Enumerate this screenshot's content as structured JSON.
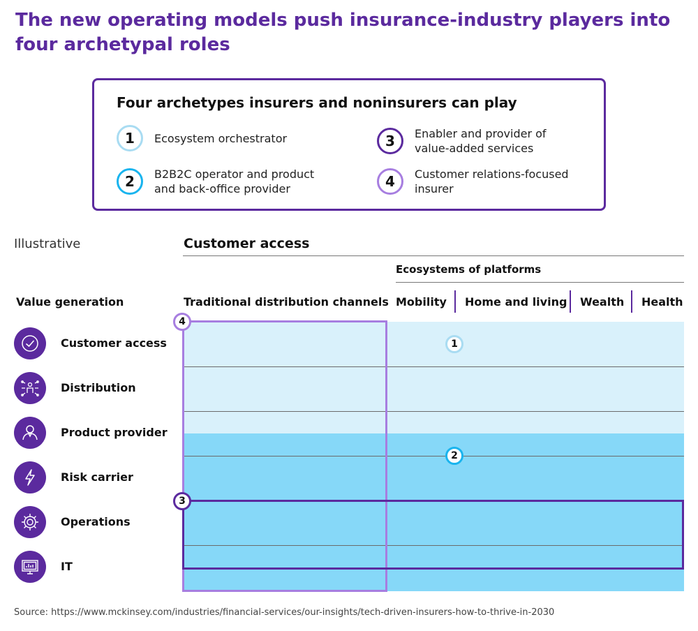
{
  "title": "The new operating models push insurance-industry players into four archetypal roles",
  "legend": {
    "heading": "Four archetypes insurers and noninsurers can play",
    "items": [
      {
        "number": "1",
        "label": "Ecosystem orchestrator",
        "color": "#a9dcf2"
      },
      {
        "number": "2",
        "label": "B2B2C operator and product and back-office provider",
        "color": "#19b4ee"
      },
      {
        "number": "3",
        "label": "Enabler and provider of value-added services",
        "color": "#5b2a9e"
      },
      {
        "number": "4",
        "label": "Customer relations-focused insurer",
        "color": "#a77ee0"
      }
    ]
  },
  "matrix": {
    "illustrative": "Illustrative",
    "customer_access_heading": "Customer access",
    "ecosystems_heading": "Ecosystems of platforms",
    "value_generation_heading": "Value generation",
    "columns": [
      "Traditional distribution channels",
      "Mobility",
      "Home and living",
      "Wealth",
      "Health"
    ],
    "rows": [
      {
        "label": "Customer access",
        "icon": "checkmark-icon"
      },
      {
        "label": "Distribution",
        "icon": "network-person-icon"
      },
      {
        "label": "Product provider",
        "icon": "person-icon"
      },
      {
        "label": "Risk carrier",
        "icon": "lightning-icon"
      },
      {
        "label": "Operations",
        "icon": "gear-icon"
      },
      {
        "label": "IT",
        "icon": "monitor-icon"
      }
    ],
    "markers": [
      "4",
      "1",
      "2",
      "3"
    ],
    "colors": {
      "light_band": "#d9f1fb",
      "mid_band": "#86d8f8",
      "purple": "#5b2a9e",
      "lilac": "#a77ee0"
    }
  },
  "source": "Source: https://www.mckinsey.com/industries/financial-services/our-insights/tech-driven-insurers-how-to-thrive-in-2030"
}
